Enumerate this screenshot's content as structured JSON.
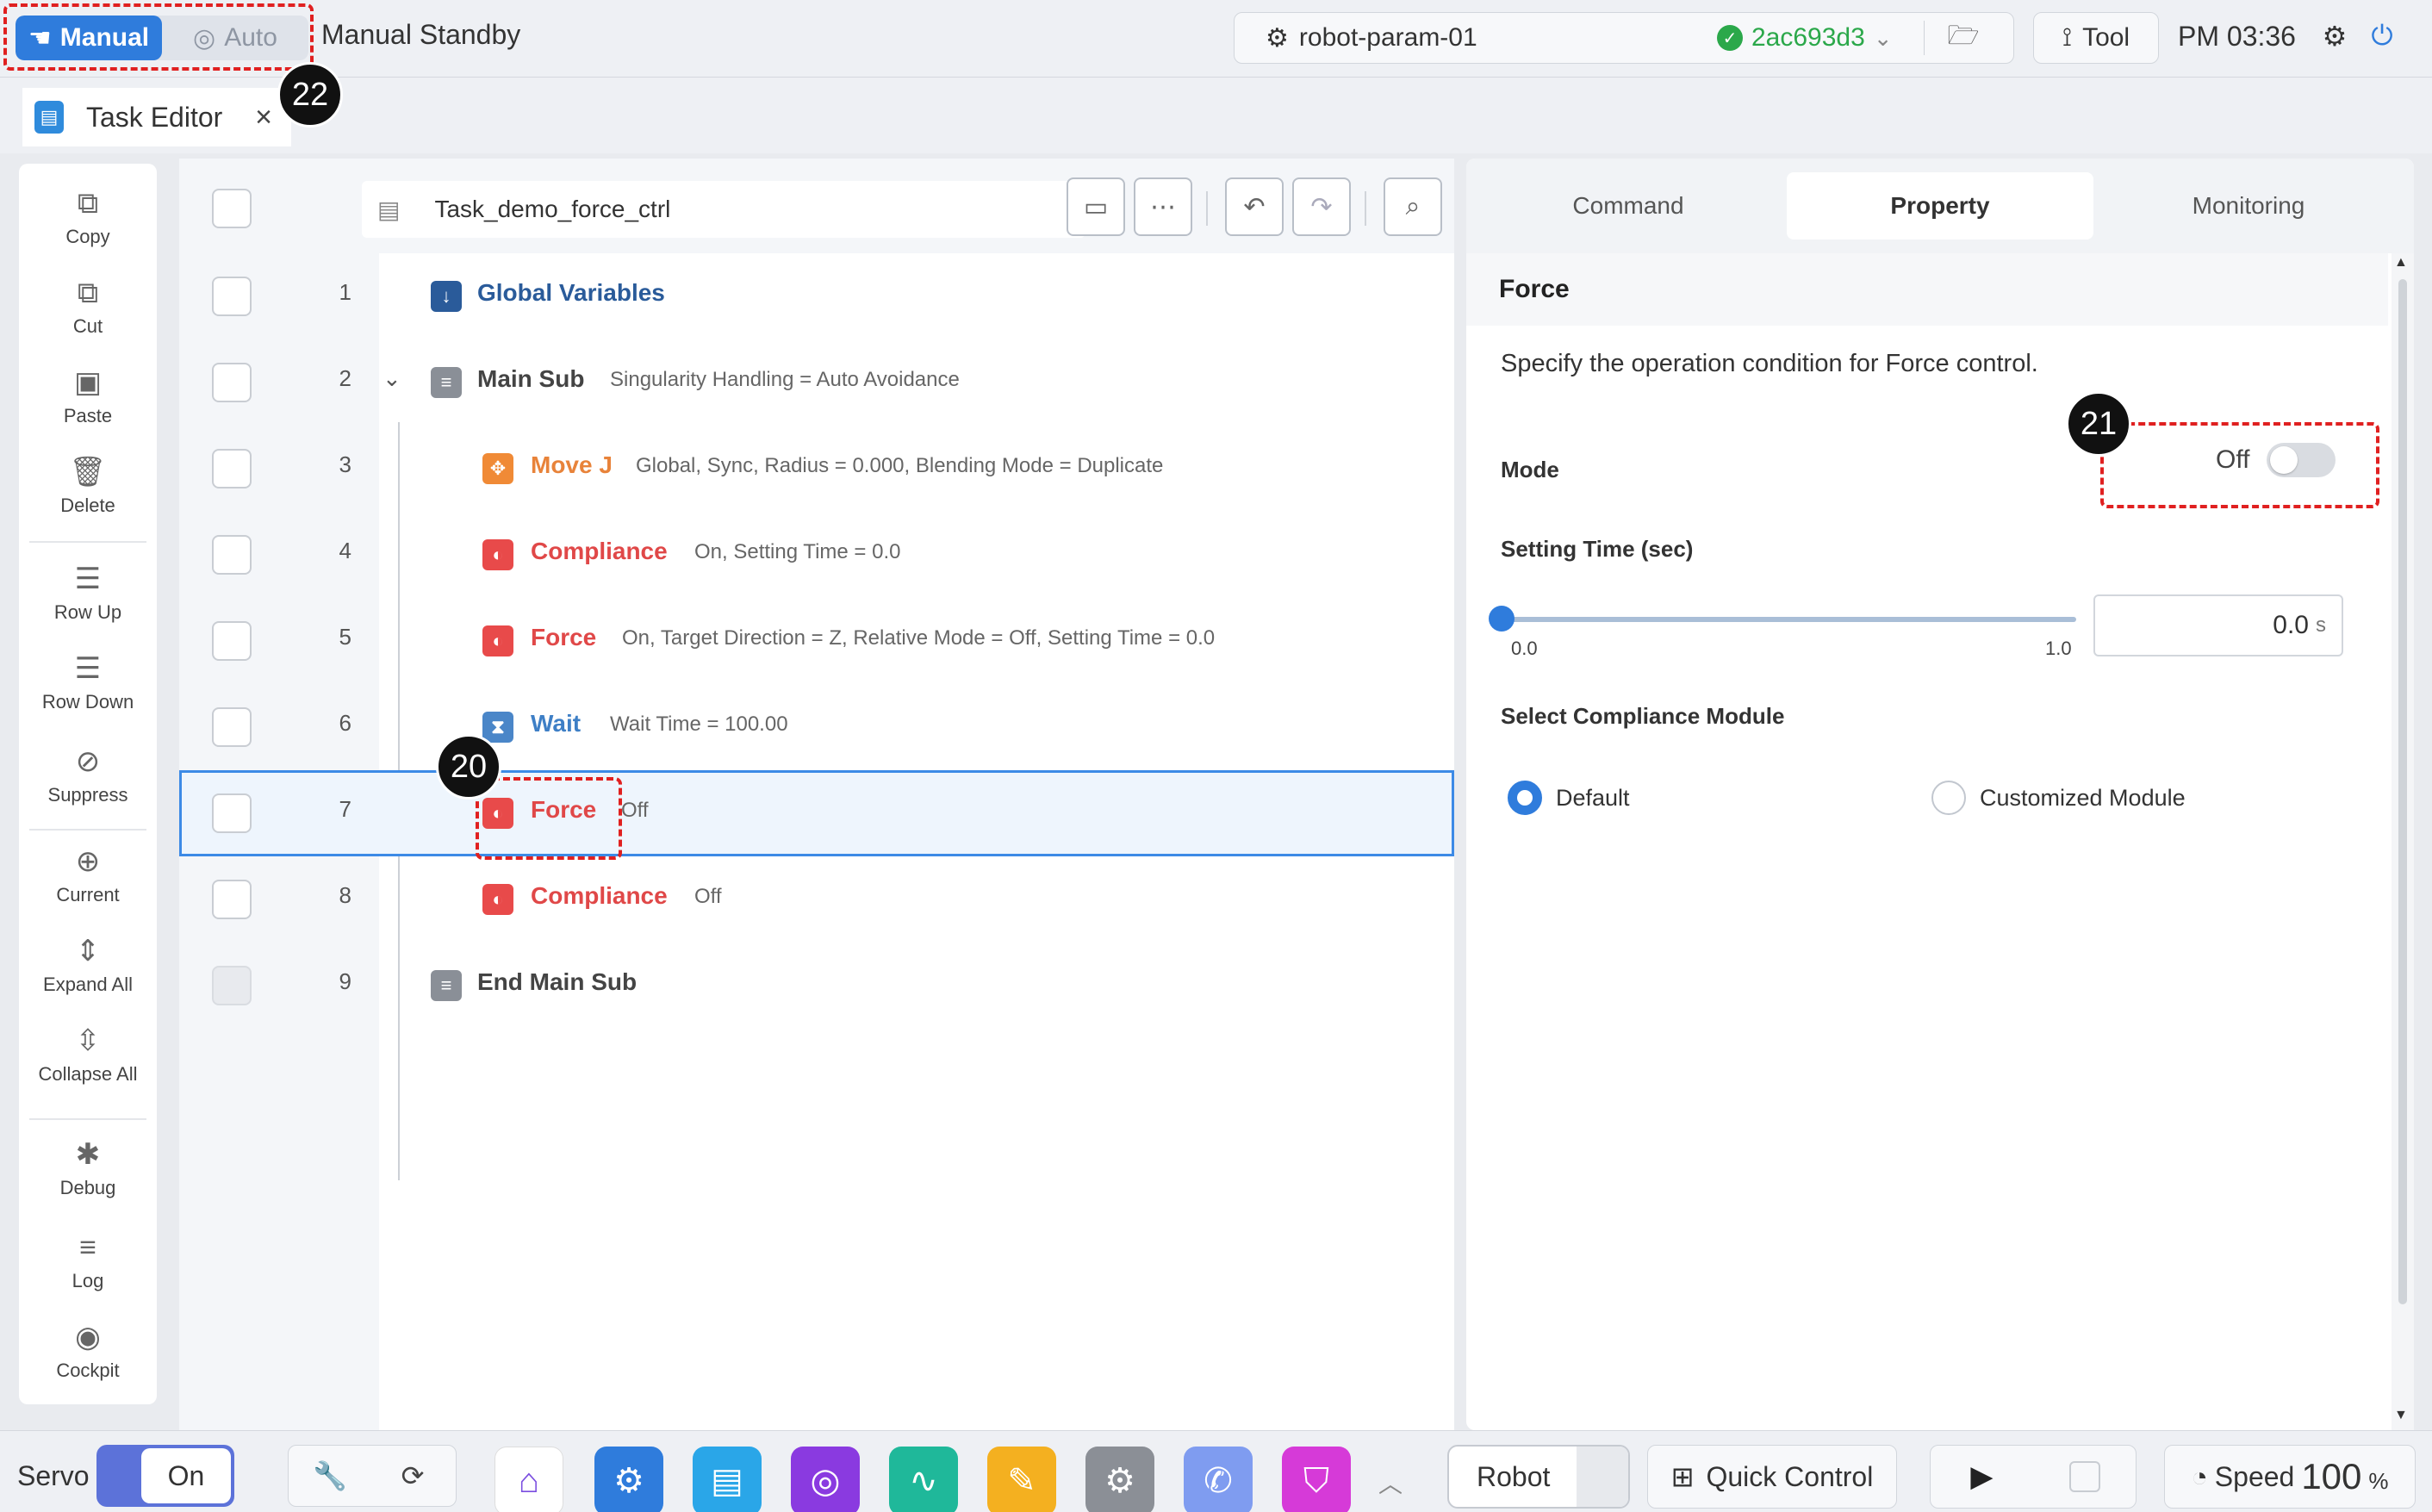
{
  "topbar": {
    "mode_manual": "Manual",
    "mode_auto": "Auto",
    "mode_status": "Manual Standby",
    "param_name": "robot-param-01",
    "commit_hash": "2ac693d3",
    "tool_label": "Tool",
    "clock": "PM 03:36"
  },
  "tab": {
    "label": "Task Editor",
    "close": "×"
  },
  "left_toolbar": [
    {
      "label": "Copy",
      "icon": "copy-icon",
      "glyph": "⧉"
    },
    {
      "label": "Cut",
      "icon": "cut-icon",
      "glyph": "⧉"
    },
    {
      "label": "Paste",
      "icon": "paste-icon",
      "glyph": "▣"
    },
    {
      "label": "Delete",
      "icon": "trash-icon",
      "glyph": "🗑"
    },
    {
      "label": "Row Up",
      "icon": "row-up-icon",
      "glyph": "☰"
    },
    {
      "label": "Row Down",
      "icon": "row-down-icon",
      "glyph": "☰"
    },
    {
      "label": "Suppress",
      "icon": "suppress-icon",
      "glyph": "⃠"
    },
    {
      "label": "Current",
      "icon": "target-icon",
      "glyph": "⊕"
    },
    {
      "label": "Expand All",
      "icon": "expand-icon",
      "glyph": "⇕"
    },
    {
      "label": "Collapse All",
      "icon": "collapse-icon",
      "glyph": "⇳"
    },
    {
      "label": "Debug",
      "icon": "bug-icon",
      "glyph": "✱"
    },
    {
      "label": "Log",
      "icon": "log-icon",
      "glyph": "≡"
    },
    {
      "label": "Cockpit",
      "icon": "cockpit-icon",
      "glyph": "◉"
    }
  ],
  "task": {
    "name": "Task_demo_force_ctrl",
    "rows": [
      {
        "num": "1",
        "name": "Global Variables",
        "params": "",
        "color": "#2a5b9a",
        "icon_bg": "#2a5b9a",
        "glyph": "↓"
      },
      {
        "num": "2",
        "name": "Main Sub",
        "params": "Singularity Handling = Auto Avoidance",
        "color": "#444444",
        "icon_bg": "#8a8f97",
        "glyph": "≡"
      },
      {
        "num": "3",
        "name": "Move J",
        "params": "Global, Sync, Radius = 0.000, Blending Mode = Duplicate",
        "color": "#e8833a",
        "icon_bg": "#f08a36",
        "glyph": "✥"
      },
      {
        "num": "4",
        "name": "Compliance",
        "params": "On, Setting Time = 0.0",
        "color": "#e04848",
        "icon_bg": "#e84a4a",
        "glyph": "◐"
      },
      {
        "num": "5",
        "name": "Force",
        "params": "On, Target Direction = Z, Relative Mode = Off, Setting Time = 0.0",
        "color": "#e04848",
        "icon_bg": "#e84a4a",
        "glyph": "◐"
      },
      {
        "num": "6",
        "name": "Wait",
        "params": "Wait Time = 100.00",
        "color": "#3e7fc6",
        "icon_bg": "#4a86c8",
        "glyph": "⧗"
      },
      {
        "num": "7",
        "name": "Force",
        "params": "Off",
        "color": "#e04848",
        "icon_bg": "#e84a4a",
        "glyph": "◐"
      },
      {
        "num": "8",
        "name": "Compliance",
        "params": "Off",
        "color": "#e04848",
        "icon_bg": "#e84a4a",
        "glyph": "◐"
      },
      {
        "num": "9",
        "name": "End Main Sub",
        "params": "",
        "color": "#444444",
        "icon_bg": "#8a8f97",
        "glyph": "≡"
      }
    ]
  },
  "property": {
    "tabs": [
      "Command",
      "Property",
      "Monitoring"
    ],
    "active_tab": "Property",
    "title": "Force",
    "description": "Specify the operation condition for Force control.",
    "mode_label": "Mode",
    "mode_value": "Off",
    "setting_time_label": "Setting Time (sec)",
    "slider_min": "0.0",
    "slider_max": "1.0",
    "setting_time_value": "0.0",
    "setting_time_unit": "s",
    "module_label": "Select Compliance Module",
    "module_options": [
      "Default",
      "Customized Module"
    ],
    "module_selected": "Default"
  },
  "bottombar": {
    "servo_label": "Servo",
    "servo_state": "On",
    "robot_label": "Robot",
    "quick_control": "Quick Control",
    "speed_label": "Speed",
    "speed_value": "100",
    "speed_unit": "%"
  },
  "annotations": {
    "badge_mode": "22",
    "badge_toggle": "21",
    "badge_force": "20"
  },
  "colors": {
    "accent": "#2f7cdc",
    "annotation": "#e02020",
    "selected_row": "#3c8ae6"
  }
}
